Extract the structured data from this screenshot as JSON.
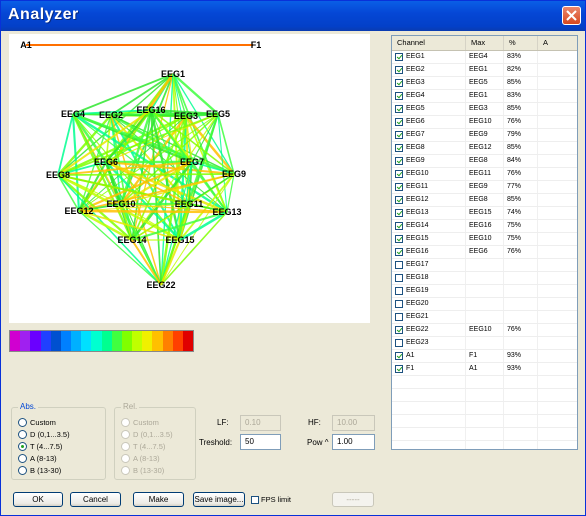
{
  "window": {
    "title": "Analyzer"
  },
  "graph": {
    "labels": {
      "EEG1": "EEG1",
      "EEG2": "EEG2",
      "EEG3": "EEG3",
      "EEG4": "EEG4",
      "EEG5": "EEG5",
      "EEG6": "EEG6",
      "EEG7": "EEG7",
      "EEG8": "EEG8",
      "EEG9": "EEG9",
      "EEG10": "EEG10",
      "EEG11": "EEG11",
      "EEG12": "EEG12",
      "EEG13": "EEG13",
      "EEG14": "EEG14",
      "EEG15": "EEG15",
      "EEG16": "EEG16",
      "EEG22": "EEG22",
      "A1": "A1",
      "F1": "F1"
    }
  },
  "colorbar": [
    "#d000d0",
    "#a020f0",
    "#6a00ff",
    "#2040ff",
    "#0050d0",
    "#0080ff",
    "#00b0ff",
    "#00e0ff",
    "#00ffd0",
    "#00ff90",
    "#40ff40",
    "#80ff00",
    "#c0ff00",
    "#f0f000",
    "#ffc000",
    "#ff8000",
    "#ff4000",
    "#e00000"
  ],
  "table": {
    "headers": [
      "Channel",
      "Max",
      "%",
      "A"
    ],
    "rows": [
      {
        "checked": true,
        "channel": "EEG1",
        "max": "EEG4",
        "pct": "83%"
      },
      {
        "checked": true,
        "channel": "EEG2",
        "max": "EEG1",
        "pct": "82%"
      },
      {
        "checked": true,
        "channel": "EEG3",
        "max": "EEG5",
        "pct": "85%"
      },
      {
        "checked": true,
        "channel": "EEG4",
        "max": "EEG1",
        "pct": "83%"
      },
      {
        "checked": true,
        "channel": "EEG5",
        "max": "EEG3",
        "pct": "85%"
      },
      {
        "checked": true,
        "channel": "EEG6",
        "max": "EEG10",
        "pct": "76%"
      },
      {
        "checked": true,
        "channel": "EEG7",
        "max": "EEG9",
        "pct": "79%"
      },
      {
        "checked": true,
        "channel": "EEG8",
        "max": "EEG12",
        "pct": "85%"
      },
      {
        "checked": true,
        "channel": "EEG9",
        "max": "EEG8",
        "pct": "84%"
      },
      {
        "checked": true,
        "channel": "EEG10",
        "max": "EEG11",
        "pct": "76%"
      },
      {
        "checked": true,
        "channel": "EEG11",
        "max": "EEG9",
        "pct": "77%"
      },
      {
        "checked": true,
        "channel": "EEG12",
        "max": "EEG8",
        "pct": "85%"
      },
      {
        "checked": true,
        "channel": "EEG13",
        "max": "EEG15",
        "pct": "74%"
      },
      {
        "checked": true,
        "channel": "EEG14",
        "max": "EEG16",
        "pct": "75%"
      },
      {
        "checked": true,
        "channel": "EEG15",
        "max": "EEG10",
        "pct": "75%"
      },
      {
        "checked": true,
        "channel": "EEG16",
        "max": "EEG6",
        "pct": "76%"
      },
      {
        "checked": false,
        "channel": "EEG17",
        "max": "",
        "pct": ""
      },
      {
        "checked": false,
        "channel": "EEG18",
        "max": "",
        "pct": ""
      },
      {
        "checked": false,
        "channel": "EEG19",
        "max": "",
        "pct": ""
      },
      {
        "checked": false,
        "channel": "EEG20",
        "max": "",
        "pct": ""
      },
      {
        "checked": false,
        "channel": "EEG21",
        "max": "",
        "pct": ""
      },
      {
        "checked": true,
        "channel": "EEG22",
        "max": "EEG10",
        "pct": "76%"
      },
      {
        "checked": false,
        "channel": "EEG23",
        "max": "",
        "pct": ""
      },
      {
        "checked": true,
        "channel": "A1",
        "max": "F1",
        "pct": "93%"
      },
      {
        "checked": true,
        "channel": "F1",
        "max": "A1",
        "pct": "93%"
      }
    ]
  },
  "abs": {
    "legend": "Abs.",
    "options": [
      "Custom",
      "D (0,1...3.5)",
      "T (4...7.5)",
      "A (8-13)",
      "B (13-30)"
    ],
    "selected": 2
  },
  "rel": {
    "legend": "Rel.",
    "options": [
      "Custom",
      "D (0,1...3.5)",
      "T (4...7.5)",
      "A (8-13)",
      "B (13-30)"
    ]
  },
  "fields": {
    "lf_label": "LF:",
    "lf_value": "0.10",
    "hf_label": "HF:",
    "hf_value": "10.00",
    "threshold_label": "Treshold:",
    "threshold_value": "50",
    "pow_label": "Pow ^",
    "pow_value": "1.00"
  },
  "buttons": {
    "ok": "OK",
    "cancel": "Cancel",
    "make": "Make",
    "save_image": "Save image...",
    "fps_label": "FPS limit",
    "dash": "-----"
  }
}
